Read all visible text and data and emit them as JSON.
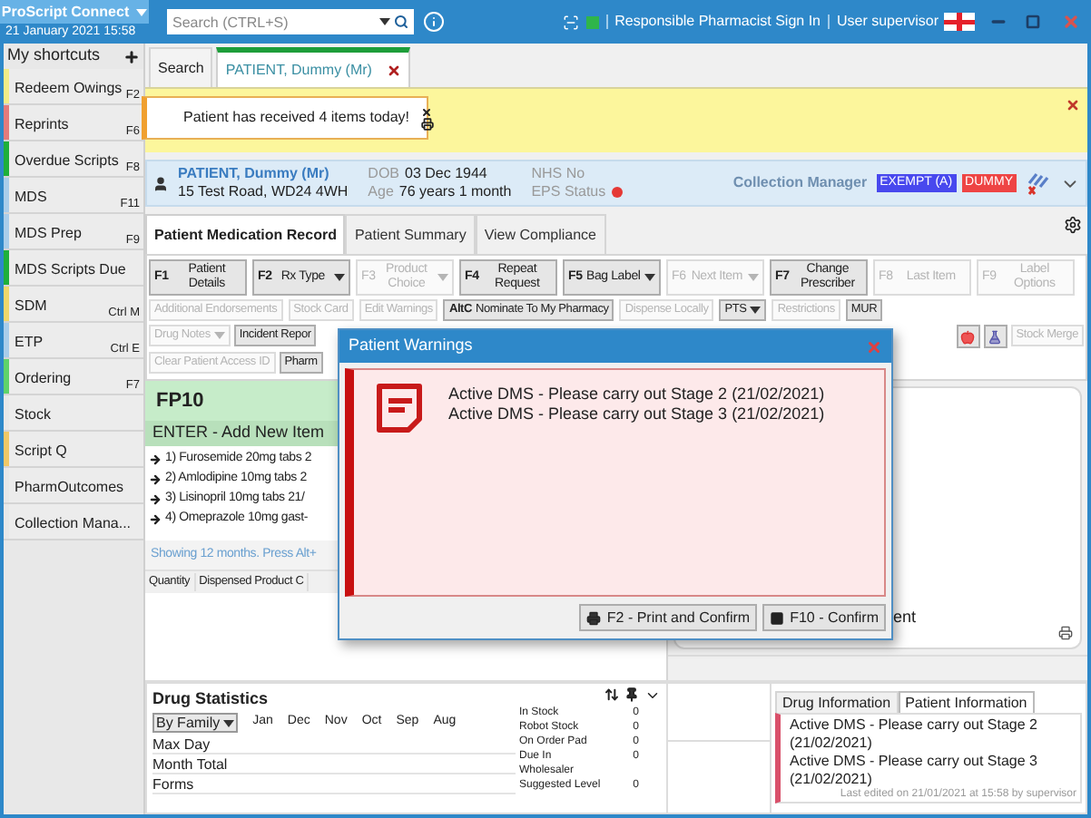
{
  "app": {
    "name": "ProScript Connect",
    "datetime": "21 January 2021 15:58"
  },
  "search": {
    "placeholder": "Search (CTRL+S)"
  },
  "header_links": [
    "Responsible Pharmacist Sign In",
    "User supervisor"
  ],
  "sidebar": {
    "title": "My shortcuts",
    "items": [
      {
        "label": "Redeem Owings",
        "shortcut": "F2",
        "color": "#f2ec86"
      },
      {
        "label": "Reprints",
        "shortcut": "F6",
        "color": "#e57b7b"
      },
      {
        "label": "Overdue Scripts",
        "shortcut": "F8",
        "color": "#1fb03a"
      },
      {
        "label": "MDS",
        "shortcut": "F11",
        "color": "#a9cdea"
      },
      {
        "label": "MDS Prep",
        "shortcut": "F9",
        "color": "#a9cdea"
      },
      {
        "label": "MDS Scripts Due",
        "color": "#1fb03a"
      },
      {
        "label": "SDM",
        "shortcut": "Ctrl M",
        "color": "#f0d76a"
      },
      {
        "label": "ETP",
        "shortcut": "Ctrl E",
        "color": "#a9cdea"
      },
      {
        "label": "Ordering",
        "shortcut": "F7",
        "color": "#5fd36a"
      },
      {
        "label": "Stock"
      },
      {
        "label": "Script Q",
        "color": "#f0c866"
      },
      {
        "label": "PharmOutcomes"
      },
      {
        "label": "Collection Mana..."
      }
    ]
  },
  "tabs": [
    {
      "label": "Search",
      "selected": false,
      "closable": false
    },
    {
      "label": "PATIENT, Dummy (Mr)",
      "selected": true,
      "closable": true
    }
  ],
  "notification": {
    "message": "Patient has received 4 items today!"
  },
  "patient": {
    "name": "PATIENT, Dummy (Mr)",
    "address": "15 Test Road, WD24 4WH",
    "dob_label": "DOB",
    "dob": "03 Dec 1944",
    "age_label": "Age",
    "age": "76 years 1 month",
    "nhs_label": "NHS No",
    "eps_label": "EPS Status",
    "collection_label": "Collection Manager",
    "badges": [
      {
        "label": "EXEMPT (A)",
        "color": "#4848ee"
      },
      {
        "label": "DUMMY",
        "color": "#ee4444"
      }
    ]
  },
  "record_tabs": [
    {
      "label": "Patient Medication Record",
      "selected": true
    },
    {
      "label": "Patient Summary",
      "selected": false
    },
    {
      "label": "View Compliance",
      "selected": false
    }
  ],
  "toolbar": {
    "function_keys": [
      {
        "key": "F1",
        "label": "Patient Details",
        "dropdown": false,
        "disabled": false
      },
      {
        "key": "F2",
        "label": "Rx Type",
        "dropdown": true,
        "disabled": false
      },
      {
        "key": "F3",
        "label": "Product Choice",
        "dropdown": true,
        "disabled": true
      },
      {
        "key": "F4",
        "label": "Repeat Request",
        "dropdown": false,
        "disabled": false
      },
      {
        "key": "F5",
        "label": "Bag Label",
        "dropdown": true,
        "disabled": false
      },
      {
        "key": "F6",
        "label": "Next Item",
        "dropdown": true,
        "disabled": true
      },
      {
        "key": "F7",
        "label": "Change Prescriber",
        "dropdown": false,
        "disabled": false
      },
      {
        "key": "F8",
        "label": "Last Item",
        "dropdown": false,
        "disabled": true
      },
      {
        "key": "F9",
        "label": "Label Options",
        "dropdown": false,
        "disabled": true
      }
    ],
    "row_2": [
      {
        "label": "Additional Endorsements",
        "dropdown": false,
        "disabled": true
      },
      {
        "label": "Stock Card",
        "dropdown": false,
        "disabled": true
      },
      {
        "label": "Edit Warnings",
        "dropdown": false,
        "disabled": true
      },
      {
        "key": "AltC",
        "label": "Nominate To My Pharmacy",
        "dropdown": false,
        "disabled": false
      },
      {
        "label": "Dispense Locally",
        "dropdown": false,
        "disabled": true
      },
      {
        "label": "PTS",
        "dropdown": true,
        "disabled": false
      },
      {
        "label": "Restrictions",
        "dropdown": false,
        "disabled": true
      },
      {
        "label": "MUR",
        "dropdown": false,
        "disabled": false
      }
    ],
    "row_3": [
      {
        "label": "Drug Notes",
        "dropdown": true,
        "disabled": true
      },
      {
        "label": "Incident Repor",
        "dropdown": false,
        "disabled": false
      }
    ],
    "row_3_right": [
      {
        "label": "Stock Merge",
        "dropdown": false,
        "disabled": true
      }
    ],
    "row_4": [
      {
        "label": "Clear Patient Access ID",
        "dropdown": false,
        "disabled": true
      },
      {
        "label": "Pharm",
        "dropdown": false,
        "disabled": false
      }
    ]
  },
  "prescription": {
    "title": "FP10",
    "action": "ENTER - Add New Item",
    "items": [
      "1) Furosemide 20mg tabs 2",
      "2) Amlodipine 10mg tabs 2",
      "3) Lisinopril 10mg tabs 21/",
      "4) Omeprazole 10mg gast-"
    ],
    "footer": "Showing 12 months. Press Alt+"
  },
  "columns": [
    "Quantity",
    "Dispensed Product C"
  ],
  "right_panel": {
    "text": "ent"
  },
  "drug_statistics": {
    "title": "Drug Statistics",
    "filter": "By Family",
    "months": [
      "Jan",
      "Dec",
      "Nov",
      "Oct",
      "Sep",
      "Aug"
    ],
    "rows": [
      "Max Day",
      "Month Total",
      "Forms"
    ],
    "stock": [
      {
        "label": "In Stock",
        "value": "0"
      },
      {
        "label": "Robot Stock",
        "value": "0"
      },
      {
        "label": "On Order Pad",
        "value": "0"
      },
      {
        "label": "Due In",
        "value": "0"
      },
      {
        "label": "Wholesaler"
      },
      {
        "label": "Suggested Level",
        "value": "0"
      }
    ]
  },
  "info_tabs": [
    {
      "label": "Drug Information",
      "selected": false
    },
    {
      "label": "Patient Information",
      "selected": true
    }
  ],
  "patient_information": {
    "warnings": [
      "Active DMS - Please carry out Stage 2 (21/02/2021)",
      "Active DMS - Please carry out Stage 3 (21/02/2021)"
    ],
    "edited": "Last edited on 21/01/2021 at 15:58 by supervisor"
  },
  "dialog": {
    "title": "Patient Warnings",
    "warnings": [
      "Active DMS - Please carry out Stage 2 (21/02/2021)",
      "Active DMS - Please carry out Stage 3 (21/02/2021)"
    ],
    "buttons": [
      {
        "label": "F2 - Print and Confirm",
        "kind": "print"
      },
      {
        "label": "F10 - Confirm",
        "kind": "confirm"
      }
    ]
  }
}
